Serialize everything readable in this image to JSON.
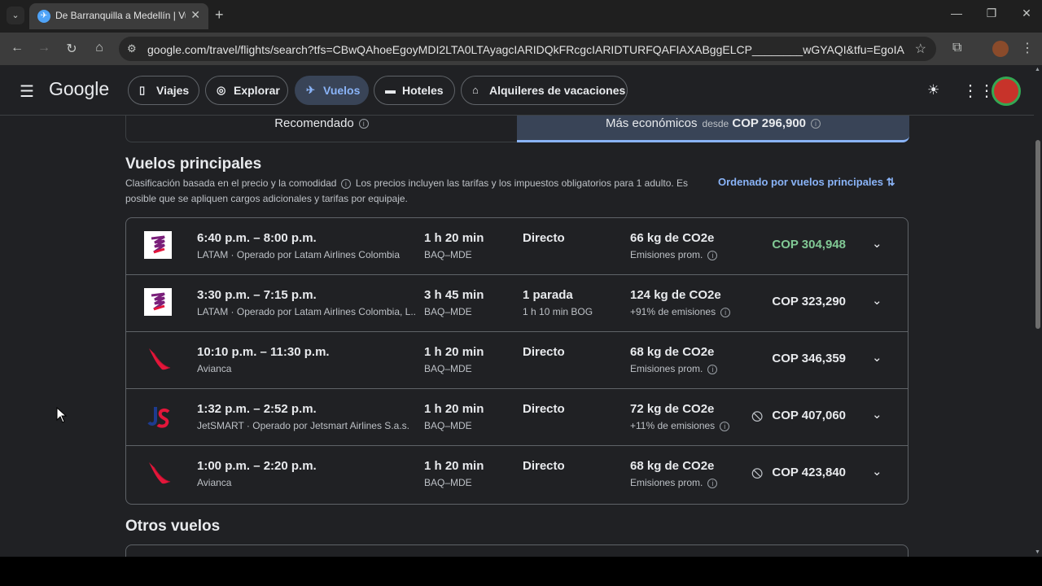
{
  "browser": {
    "tab_title": "De Barranquilla a Medellín | Vu",
    "url": "google.com/travel/flights/search?tfs=CBwQAhoeEgoyMDI2LTA0LTAyagcIARIDQkFRcgcIARIDTURFQAFIAXABggELCP________wGYAQI&tfu=EgoIABAAGAAgAig..."
  },
  "header": {
    "logo": "Google",
    "nav": [
      {
        "label": "Viajes",
        "icon": "luggage-icon"
      },
      {
        "label": "Explorar",
        "icon": "explore-icon"
      },
      {
        "label": "Vuelos",
        "icon": "plane-icon",
        "active": true
      },
      {
        "label": "Hoteles",
        "icon": "bed-icon"
      },
      {
        "label": "Alquileres de vacaciones",
        "icon": "house-icon"
      }
    ]
  },
  "sort": {
    "recommended": "Recomendado",
    "cheapest": "Más económicos",
    "cheapest_from": "desde",
    "cheapest_price": "COP 296,900"
  },
  "main": {
    "title": "Vuelos principales",
    "subtitle_a": "Clasificación basada en el precio y la comodidad",
    "subtitle_b": "Los precios incluyen las tarifas y los impuestos obligatorios para 1 adulto. Es posible que se apliquen cargos adicionales y tarifas por equipaje.",
    "sort_link": "Ordenado por vuelos principales",
    "other_title": "Otros vuelos"
  },
  "flights": [
    {
      "logo": "latam",
      "times": "6:40 p.m. – 8:00 p.m.",
      "airline": "LATAM · Operado por Latam Airlines Colombia",
      "duration": "1 h 20 min",
      "route": "BAQ–MDE",
      "stops": "Directo",
      "stops_detail": "",
      "co2": "66 kg de CO2e",
      "emissions": "Emisiones prom.",
      "price": "COP 304,948",
      "price_green": true,
      "no_bag": false
    },
    {
      "logo": "latam",
      "times": "3:30 p.m. – 7:15 p.m.",
      "airline": "LATAM · Operado por Latam Airlines Colombia, L...",
      "duration": "3 h 45 min",
      "route": "BAQ–MDE",
      "stops": "1 parada",
      "stops_detail": "1 h 10 min BOG",
      "co2": "124 kg de CO2e",
      "emissions": "+91% de emisiones",
      "price": "COP 323,290",
      "price_green": false,
      "no_bag": false
    },
    {
      "logo": "avianca",
      "times": "10:10 p.m. – 11:30 p.m.",
      "airline": "Avianca",
      "duration": "1 h 20 min",
      "route": "BAQ–MDE",
      "stops": "Directo",
      "stops_detail": "",
      "co2": "68 kg de CO2e",
      "emissions": "Emisiones prom.",
      "price": "COP 346,359",
      "price_green": false,
      "no_bag": false
    },
    {
      "logo": "jetsmart",
      "times": "1:32 p.m. – 2:52 p.m.",
      "airline": "JetSMART · Operado por Jetsmart Airlines S.a.s.",
      "duration": "1 h 20 min",
      "route": "BAQ–MDE",
      "stops": "Directo",
      "stops_detail": "",
      "co2": "72 kg de CO2e",
      "emissions": "+11% de emisiones",
      "price": "COP 407,060",
      "price_green": false,
      "no_bag": true
    },
    {
      "logo": "avianca",
      "times": "1:00 p.m. – 2:20 p.m.",
      "airline": "Avianca",
      "duration": "1 h 20 min",
      "route": "BAQ–MDE",
      "stops": "Directo",
      "stops_detail": "",
      "co2": "68 kg de CO2e",
      "emissions": "Emisiones prom.",
      "price": "COP 423,840",
      "price_green": false,
      "no_bag": true
    }
  ],
  "colors": {
    "accent": "#8ab4f8",
    "green_price": "#81c995",
    "background": "#202124"
  }
}
